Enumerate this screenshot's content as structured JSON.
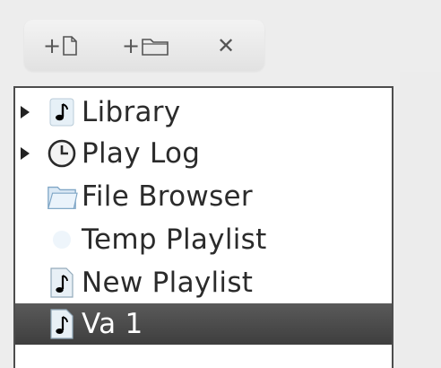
{
  "toolbar": {
    "add_playlist_icon": "plus-file-icon",
    "add_folder_icon": "plus-folder-icon",
    "remove_icon": "close-icon",
    "remove_label": "✕",
    "plus_label": "+"
  },
  "sidebar": {
    "items": [
      {
        "label": "Library",
        "icon": "music-note-icon",
        "expandable": true
      },
      {
        "label": "Play Log",
        "icon": "clock-icon",
        "expandable": true
      },
      {
        "label": "File Browser",
        "icon": "folder-icon",
        "expandable": false
      },
      {
        "label": "Temp Playlist",
        "icon": "temp-playlist-icon",
        "expandable": false
      },
      {
        "label": "New Playlist",
        "icon": "playlist-icon",
        "expandable": false
      },
      {
        "label": "Va 1",
        "icon": "playlist-icon",
        "expandable": false,
        "selected": true
      }
    ]
  },
  "colors": {
    "selected_row": "#464646",
    "panel_border": "#4d4d4d",
    "background": "#ededed"
  }
}
